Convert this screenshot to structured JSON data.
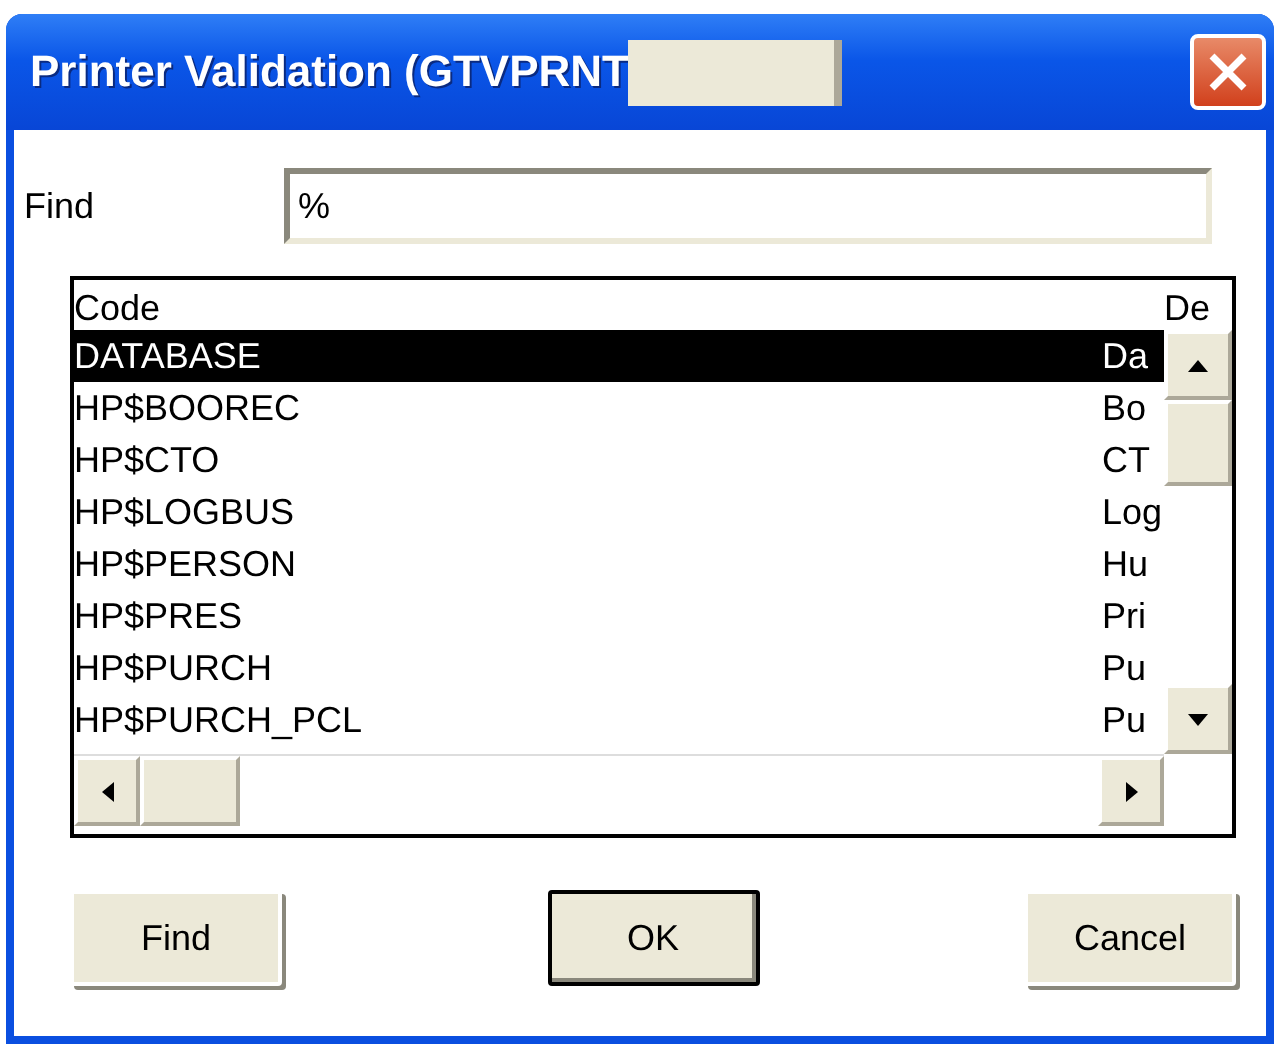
{
  "window": {
    "title": "Printer Validation (GTVPRNT"
  },
  "find": {
    "label": "Find",
    "value": "%"
  },
  "list": {
    "columns": [
      "Code",
      "De"
    ],
    "rows": [
      {
        "code": "DATABASE",
        "description": "Da",
        "selected": true
      },
      {
        "code": "HP$BOOREC",
        "description": "Bo",
        "selected": false
      },
      {
        "code": "HP$CTO",
        "description": "CT",
        "selected": false
      },
      {
        "code": "HP$LOGBUS",
        "description": "Log",
        "selected": false
      },
      {
        "code": "HP$PERSON",
        "description": "Hu",
        "selected": false
      },
      {
        "code": "HP$PRES",
        "description": "Pri",
        "selected": false
      },
      {
        "code": "HP$PURCH",
        "description": "Pu",
        "selected": false
      },
      {
        "code": "HP$PURCH_PCL",
        "description": "Pu",
        "selected": false
      }
    ]
  },
  "buttons": [
    {
      "label": "Find",
      "default": false
    },
    {
      "label": "OK",
      "default": true
    },
    {
      "label": "Cancel",
      "default": false
    }
  ]
}
